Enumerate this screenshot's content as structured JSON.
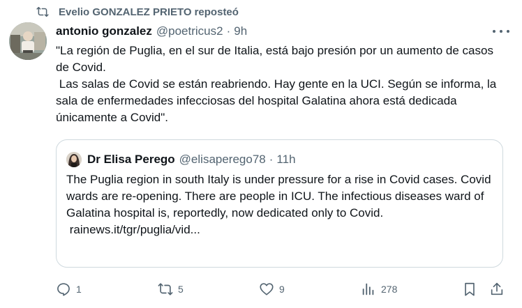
{
  "repost": {
    "icon": "repost-icon",
    "name": "Evelio GONZALEZ PRIETO",
    "suffix": "reposteó"
  },
  "tweet": {
    "author": {
      "display_name": "antonio gonzalez",
      "handle": "@poetricus2",
      "time": "9h",
      "separator": "·"
    },
    "text_lines": [
      "\"La región de Puglia, en el sur de Italia, está bajo presión por un aumento de casos de Covid.",
      " Las salas de Covid se están reabriendo. Hay gente en la UCI. Según se informa, la sala de enfermedades infecciosas del hospital Galatina ahora está dedicada únicamente a Covid\"."
    ]
  },
  "quote": {
    "author": {
      "display_name": "Dr Elisa Perego",
      "handle": "@elisaperego78",
      "time": "11h",
      "separator": "·"
    },
    "text_lines": [
      "The Puglia region in south Italy is under pressure for a rise in Covid cases. Covid wards are re-opening. There are people in ICU. The infectious diseases ward of Galatina hospital is, reportedly, now dedicated only to Covid.",
      " rainews.it/tgr/puglia/vid..."
    ]
  },
  "actions": {
    "reply": {
      "icon": "reply-icon",
      "count": "1"
    },
    "repost": {
      "icon": "repost-icon",
      "count": "5"
    },
    "like": {
      "icon": "heart-icon",
      "count": "9"
    },
    "views": {
      "icon": "views-icon",
      "count": "278"
    },
    "bookmark": {
      "icon": "bookmark-icon"
    },
    "share": {
      "icon": "share-icon"
    }
  },
  "colors": {
    "text": "#0f1419",
    "secondary": "#536471",
    "border": "#cfd9de",
    "background": "#ffffff"
  }
}
